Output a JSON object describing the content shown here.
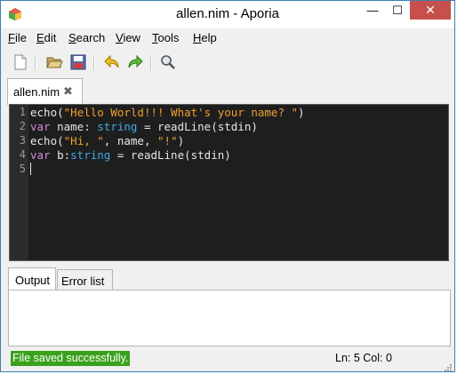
{
  "window": {
    "title": "allen.nim - Aporia",
    "minimize_glyph": "—",
    "maximize_glyph": "☐",
    "close_glyph": "✕"
  },
  "menu": [
    {
      "name": "File",
      "accel": "F",
      "rest": "ile"
    },
    {
      "name": "Edit",
      "accel": "E",
      "rest": "dit"
    },
    {
      "name": "Search",
      "accel": "S",
      "rest": "earch"
    },
    {
      "name": "View",
      "accel": "V",
      "rest": "iew"
    },
    {
      "name": "Tools",
      "accel": "T",
      "rest": "ools"
    },
    {
      "name": "Help",
      "accel": "H",
      "rest": "elp"
    }
  ],
  "toolbar": {
    "icons": [
      "new-file-icon",
      "open-folder-icon",
      "save-icon",
      "undo-icon",
      "redo-icon",
      "find-icon"
    ]
  },
  "editor_tab": {
    "label": "allen.nim",
    "close_glyph": "✖"
  },
  "editor": {
    "line_numbers": [
      "1",
      "2",
      "3",
      "4",
      "5"
    ],
    "lines": [
      [
        {
          "t": "echo(",
          "c": "plain"
        },
        {
          "t": "\"Hello World!!! What's your name? \"",
          "c": "str"
        },
        {
          "t": ")",
          "c": "plain"
        }
      ],
      [
        {
          "t": "var",
          "c": "kw"
        },
        {
          "t": " name: ",
          "c": "plain"
        },
        {
          "t": "string",
          "c": "ty"
        },
        {
          "t": " = readLine(stdin)",
          "c": "plain"
        }
      ],
      [
        {
          "t": "echo(",
          "c": "plain"
        },
        {
          "t": "\"Hi, \"",
          "c": "str"
        },
        {
          "t": ", name, ",
          "c": "plain"
        },
        {
          "t": "\"!\"",
          "c": "str"
        },
        {
          "t": ")",
          "c": "plain"
        }
      ],
      [
        {
          "t": "var",
          "c": "kw"
        },
        {
          "t": " b:",
          "c": "plain"
        },
        {
          "t": "string",
          "c": "ty"
        },
        {
          "t": " = readLine(stdin)",
          "c": "plain"
        }
      ],
      []
    ]
  },
  "bottom_panel": {
    "tabs": [
      "Output",
      "Error list"
    ]
  },
  "status": {
    "message": "File saved successfully.",
    "position": "Ln: 5 Col: 0"
  },
  "colors": {
    "keyword": "#d38bd7",
    "string": "#f0a030",
    "type": "#3fa9e6",
    "status_success": "#3aa11c",
    "editor_bg": "#1e1e1e"
  }
}
